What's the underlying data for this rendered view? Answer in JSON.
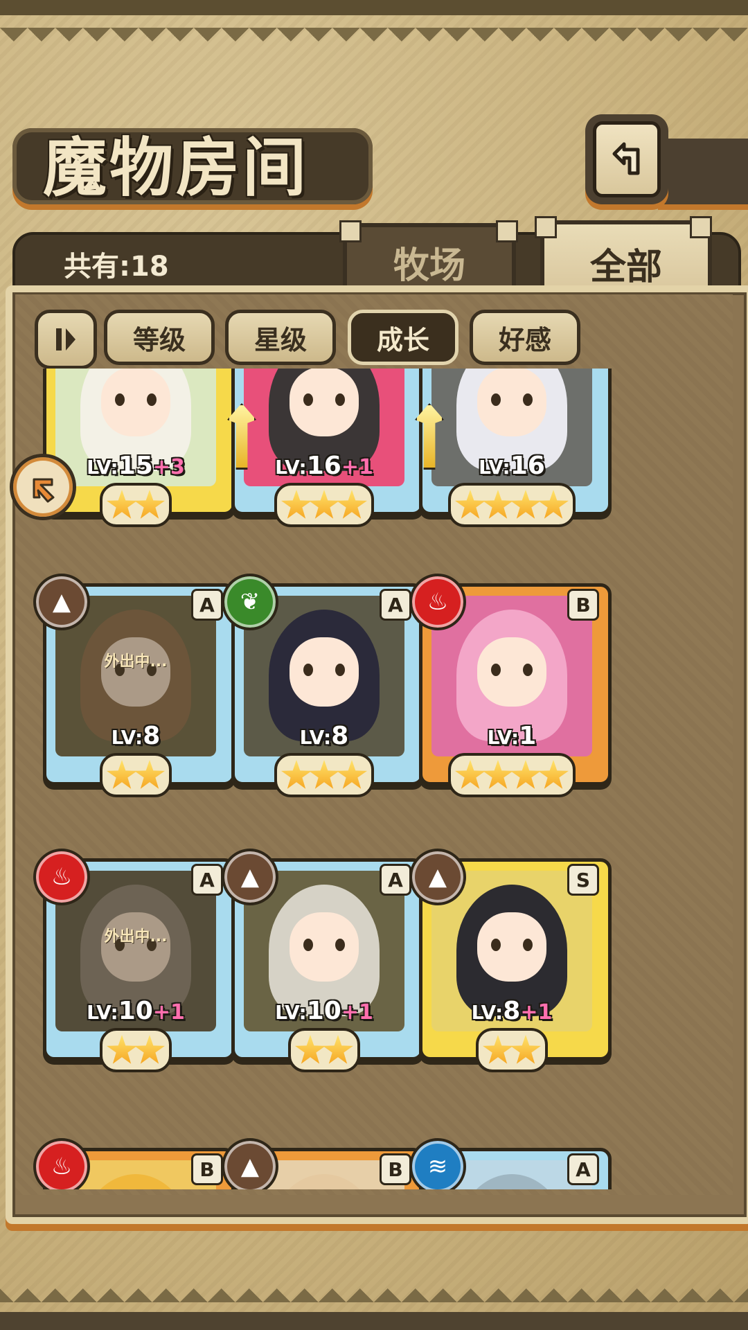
{
  "header": {
    "title": "魔物房间",
    "back_icon": "back-arrow-icon"
  },
  "tabs": {
    "count_label": "共有:18",
    "ranch": "牧场",
    "all": "全部"
  },
  "filters": {
    "toggle_icon": "pause-sort-icon",
    "level": "等级",
    "star": "星级",
    "growth": "成长",
    "affection": "好感",
    "active": "growth"
  },
  "monsters": [
    {
      "lv_prefix": "LV:",
      "lv": "15",
      "bonus": "+3",
      "stars": 2,
      "frame": "yellow",
      "grade": "",
      "element": "",
      "weapon": false,
      "away": ""
    },
    {
      "lv_prefix": "LV:",
      "lv": "16",
      "bonus": "+1",
      "stars": 3,
      "frame": "blue",
      "grade": "",
      "element": "",
      "weapon": true,
      "away": ""
    },
    {
      "lv_prefix": "LV:",
      "lv": "16",
      "bonus": "",
      "stars": 4,
      "frame": "blue",
      "grade": "",
      "element": "",
      "weapon": true,
      "away": ""
    },
    {
      "lv_prefix": "LV:",
      "lv": "8",
      "bonus": "",
      "stars": 2,
      "frame": "blue",
      "grade": "A",
      "element": "earth",
      "weapon": false,
      "away": "外出中..."
    },
    {
      "lv_prefix": "LV:",
      "lv": "8",
      "bonus": "",
      "stars": 3,
      "frame": "blue",
      "grade": "A",
      "element": "nature",
      "weapon": false,
      "away": ""
    },
    {
      "lv_prefix": "LV:",
      "lv": "1",
      "bonus": "",
      "stars": 4,
      "frame": "orange",
      "grade": "B",
      "element": "fire",
      "weapon": false,
      "away": ""
    },
    {
      "lv_prefix": "LV:",
      "lv": "10",
      "bonus": "+1",
      "stars": 2,
      "frame": "blue",
      "grade": "A",
      "element": "fire",
      "weapon": false,
      "away": "外出中..."
    },
    {
      "lv_prefix": "LV:",
      "lv": "10",
      "bonus": "+1",
      "stars": 2,
      "frame": "blue",
      "grade": "A",
      "element": "earth",
      "weapon": false,
      "away": ""
    },
    {
      "lv_prefix": "LV:",
      "lv": "8",
      "bonus": "+1",
      "stars": 2,
      "frame": "yellow",
      "grade": "S",
      "element": "earth",
      "weapon": false,
      "away": ""
    },
    {
      "lv_prefix": "",
      "lv": "",
      "bonus": "",
      "stars": 0,
      "frame": "orange",
      "grade": "B",
      "element": "fire",
      "weapon": false,
      "away": ""
    },
    {
      "lv_prefix": "",
      "lv": "",
      "bonus": "",
      "stars": 0,
      "frame": "orange",
      "grade": "B",
      "element": "earth",
      "weapon": false,
      "away": ""
    },
    {
      "lv_prefix": "",
      "lv": "",
      "bonus": "",
      "stars": 0,
      "frame": "blue",
      "grade": "A",
      "element": "water",
      "weapon": false,
      "away": ""
    }
  ],
  "colors": {
    "hair": [
      "#f3f1e6",
      "#3b3636",
      "#e9e9ef",
      "#8a6a4a",
      "#2b2a3a",
      "#f3a6c8",
      "#8c8378",
      "#d6d2c6",
      "#2c2b30",
      "#f0b83c",
      "#e5c9a0",
      "#9fb6c2"
    ],
    "bg": [
      "#dbe8c0",
      "#e8507a",
      "#6d6f6b",
      "#6a6445",
      "#5c5a48",
      "#e070a0",
      "#5e5a48",
      "#6a6445",
      "#e8d36a",
      "#f0c860",
      "#e7cfa8",
      "#bcd8e6"
    ]
  }
}
